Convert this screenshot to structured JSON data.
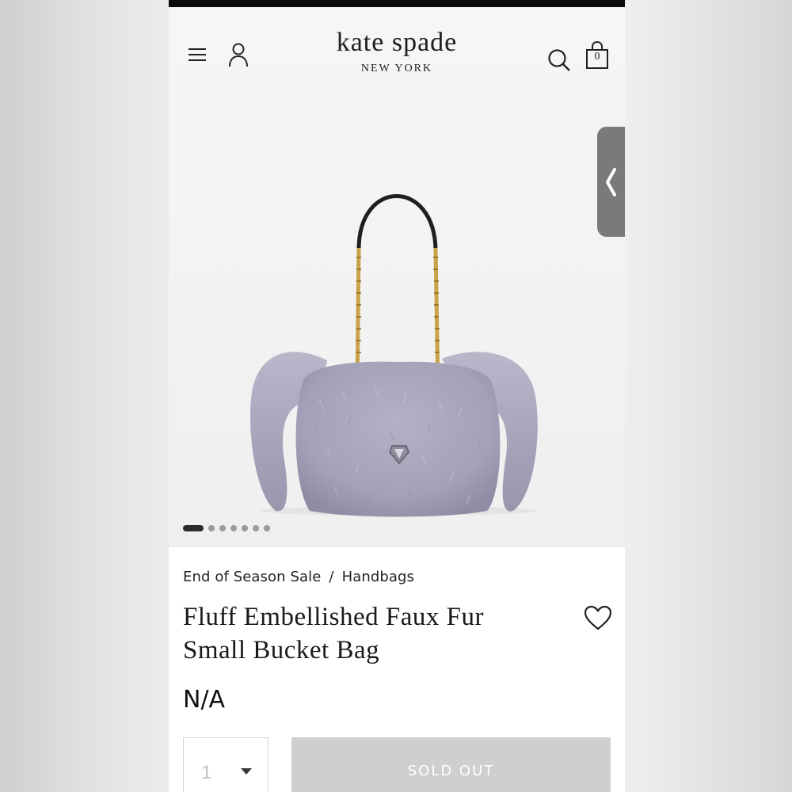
{
  "header": {
    "logo_main": "kate spade",
    "logo_sub": "NEW YORK",
    "cart_count": "0",
    "icons": [
      "menu-icon",
      "account-icon",
      "search-icon",
      "shopping-bag-icon"
    ]
  },
  "gallery": {
    "image_alt": "Fluff Embellished Faux Fur Small Bucket Bag",
    "slide_count": 7,
    "active_slide": 1,
    "side_tab_icon": "chevron-left-icon"
  },
  "product": {
    "breadcrumb": [
      "End of Season Sale",
      "Handbags"
    ],
    "breadcrumb_separator": "/",
    "title_line1": "Fluff Embellished Faux Fur",
    "title_line2": "Small Bucket Bag",
    "price": "N/A",
    "wishlist_icon": "heart-icon"
  },
  "purchase": {
    "quantity": "1",
    "button_label": "SOLD OUT"
  },
  "colors": {
    "fur": "#a9a7bd",
    "chain": "#c9a24a",
    "strap": "#1f1f1f",
    "button_disabled": "#cfcfcf"
  }
}
